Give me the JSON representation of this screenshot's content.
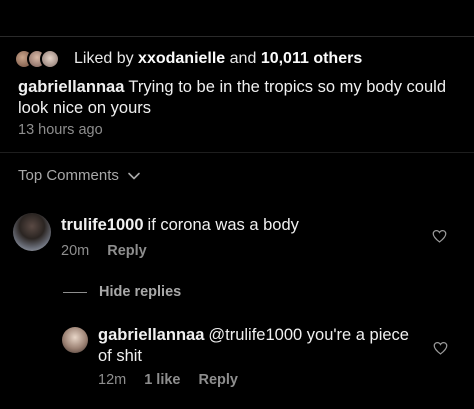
{
  "post": {
    "liked_by_prefix": "Liked by",
    "liked_by_user": "xxodanielle",
    "liked_by_and": "and",
    "liked_by_others": "10,011 others",
    "caption_user": "gabriellannaa",
    "caption_text": "Trying to be in the tropics so my body could look nice on yours",
    "caption_time": "13 hours ago"
  },
  "comments_header": {
    "label": "Top Comments",
    "icon": "chevron-down-icon"
  },
  "comments": [
    {
      "user": "trulife1000",
      "text": "if corona was a body",
      "time": "20m",
      "reply_label": "Reply"
    }
  ],
  "replies_toggle": {
    "label": "Hide replies"
  },
  "replies": [
    {
      "user": "gabriellannaa",
      "text": "@trulife1000 you're a piece of shit",
      "time": "12m",
      "likes": "1 like",
      "reply_label": "Reply"
    }
  ],
  "colors": {
    "background": "#000000",
    "text_primary": "#f0f0f0",
    "text_secondary": "#8e8e8e"
  }
}
